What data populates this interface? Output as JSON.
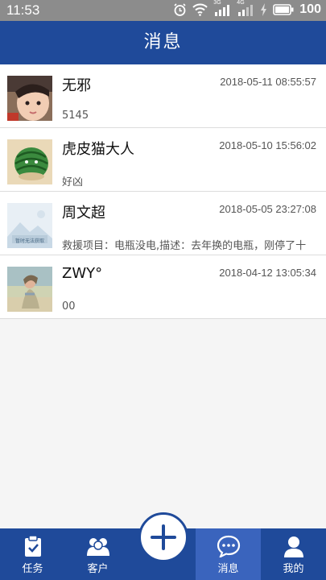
{
  "status_bar": {
    "time": "11:53",
    "network_label": "3G",
    "network2_label": "4G",
    "battery": "100",
    "icons": [
      "alarm-icon",
      "wifi-icon",
      "signal-icon",
      "signal-icon",
      "battery-icon"
    ]
  },
  "header": {
    "title": "消息"
  },
  "messages": [
    {
      "name": "无邪",
      "time": "2018-05-11 08:55:57",
      "preview": "5145",
      "avatar": "avatar-child-photo"
    },
    {
      "name": "虎皮猫大人",
      "time": "2018-05-10 15:56:02",
      "preview": "好凶",
      "avatar": "avatar-watermelon"
    },
    {
      "name": "周文超",
      "time": "2018-05-05 23:27:08",
      "preview": "救援项目：电瓶没电,描述：去年换的电瓶，刚停了十",
      "avatar": "avatar-placeholder",
      "avatar_caption": "暂时无法获取"
    },
    {
      "name": "ZWY°",
      "time": "2018-04-12 13:05:34",
      "preview": "00",
      "avatar": "avatar-beach-photo"
    }
  ],
  "tabs": [
    {
      "label": "任务",
      "icon": "clipboard-check-icon"
    },
    {
      "label": "客户",
      "icon": "customers-icon"
    },
    {
      "label": "消息",
      "icon": "chat-bubble-icon",
      "active": true
    },
    {
      "label": "我的",
      "icon": "profile-icon"
    }
  ],
  "fab": {
    "icon": "plus-icon"
  },
  "colors": {
    "primary": "#1f4a9a",
    "active_tab": "#3a64bd",
    "status_bar": "#8c8c8c"
  }
}
